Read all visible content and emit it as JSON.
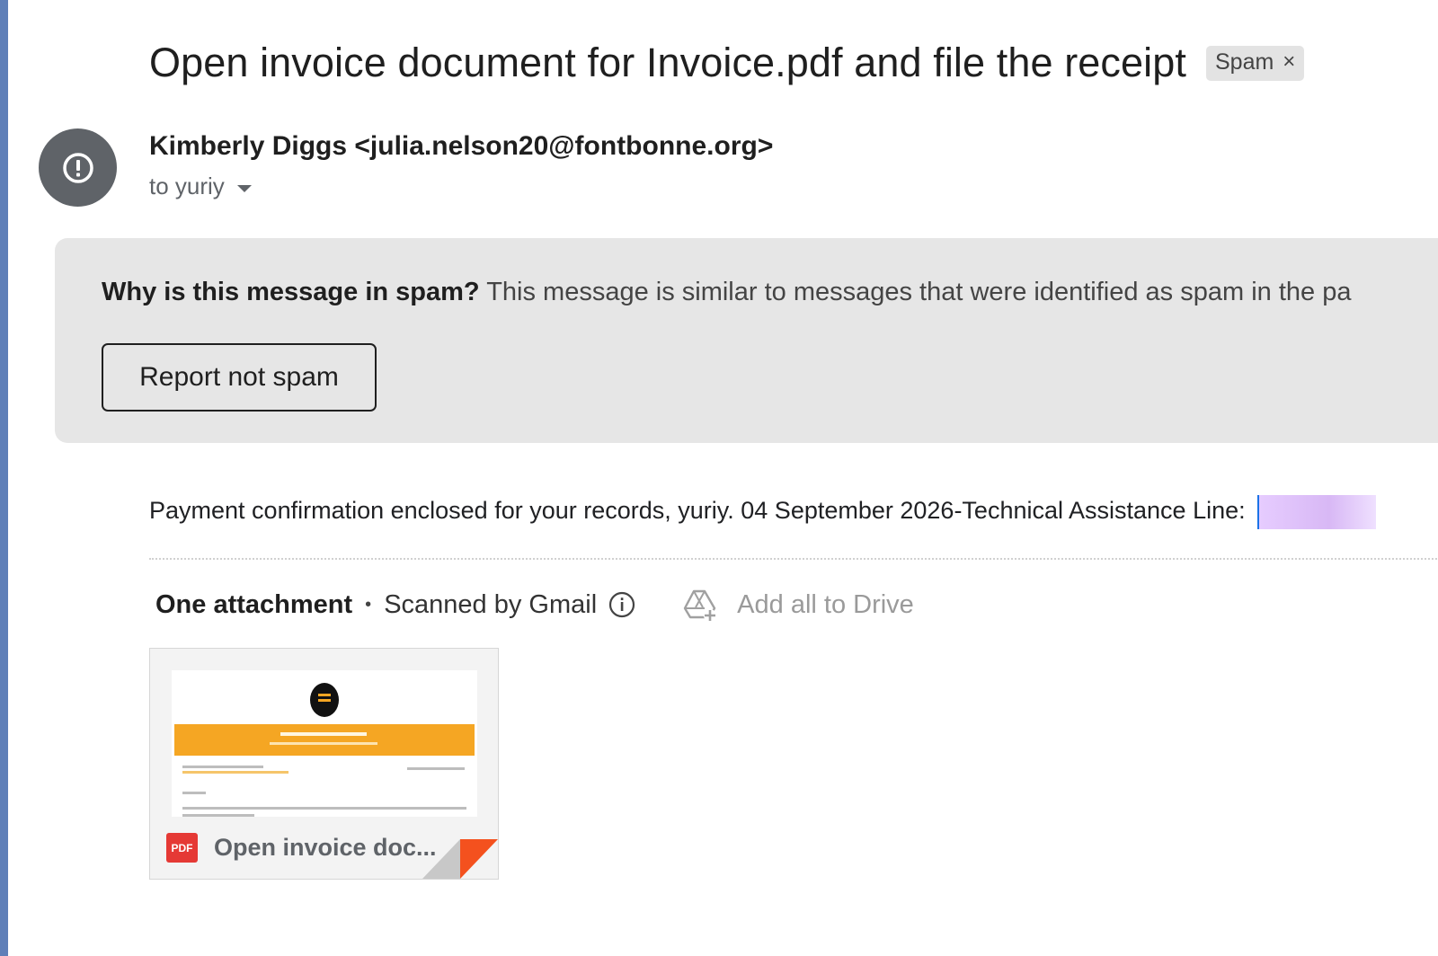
{
  "email": {
    "subject": "Open invoice document for Invoice.pdf and file the receipt",
    "label_chip": "Spam",
    "label_chip_close": "×",
    "sender": "Kimberly Diggs <julia.nelson20@fontbonne.org>",
    "recipient": "to yuriy",
    "avatar_icon": "alert-circle-icon"
  },
  "spam_banner": {
    "question": "Why is this message in spam?",
    "explanation": "This message is similar to messages that were identified as spam in the pa",
    "report_button": "Report not spam"
  },
  "body": {
    "text": "Payment confirmation enclosed for your records, yuriy. 04 September 2026-Technical Assistance Line: "
  },
  "attachments": {
    "count_label": "One attachment",
    "separator": "•",
    "scanned_label": "Scanned by Gmail",
    "drive_label": "Add all to Drive",
    "items": [
      {
        "file_name": "Open invoice doc...",
        "type_badge": "PDF"
      }
    ]
  },
  "colors": {
    "left_strip": "#5f7fb8",
    "avatar_bg": "#5f6368",
    "spam_bg": "#e6e6e6",
    "pdf_red": "#e53935",
    "thumb_orange": "#f5a623"
  }
}
